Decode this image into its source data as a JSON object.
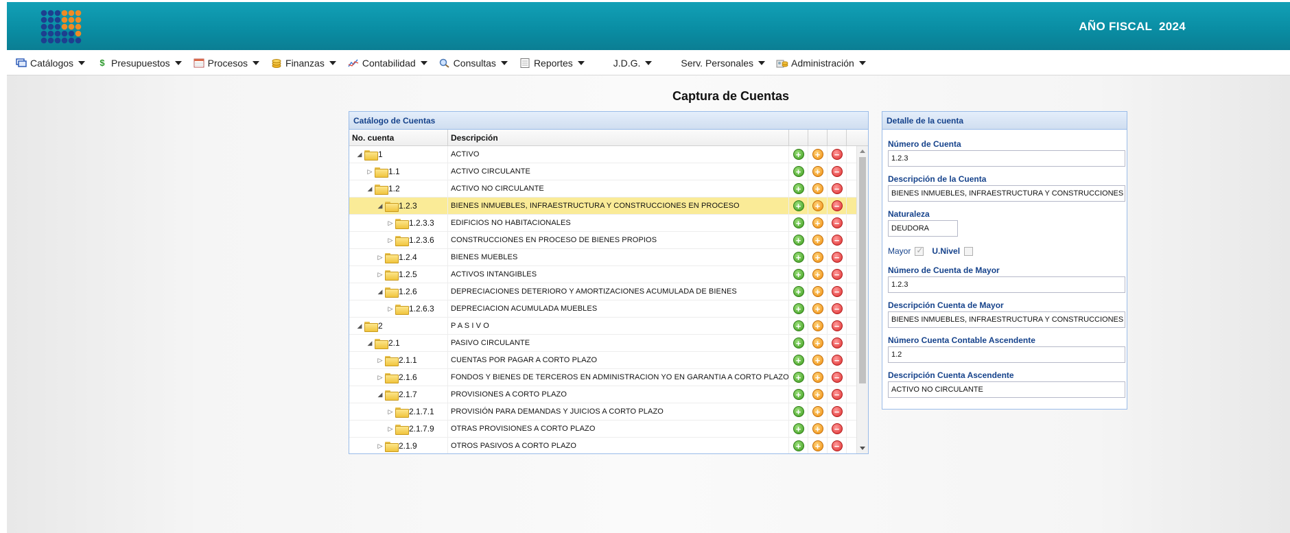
{
  "header": {
    "fiscal_label": "AÑO FISCAL  2024",
    "logo_icon": "app-logo-icon"
  },
  "menu": [
    {
      "label": "Catálogos",
      "icon": "catalog-icon"
    },
    {
      "label": "Presupuestos",
      "icon": "dollar-icon"
    },
    {
      "label": "Procesos",
      "icon": "calendar-icon"
    },
    {
      "label": "Finanzas",
      "icon": "coins-icon"
    },
    {
      "label": "Contabilidad",
      "icon": "chart-icon"
    },
    {
      "label": "Consultas",
      "icon": "search-icon"
    },
    {
      "label": "Reportes",
      "icon": "report-icon"
    },
    {
      "label": "J.D.G.",
      "icon": ""
    },
    {
      "label": "Serv. Personales",
      "icon": ""
    },
    {
      "label": "Administración",
      "icon": "admin-icon"
    }
  ],
  "page": {
    "title": "Captura de Cuentas"
  },
  "catalog": {
    "title": "Catálogo de Cuentas",
    "columns": {
      "number": "No. cuenta",
      "description": "Descripción"
    },
    "rows": [
      {
        "num": "1",
        "desc": "ACTIVO",
        "level": 0,
        "expanded": true,
        "selected": false
      },
      {
        "num": "1.1",
        "desc": "ACTIVO CIRCULANTE",
        "level": 1,
        "expanded": false,
        "selected": false
      },
      {
        "num": "1.2",
        "desc": "ACTIVO NO CIRCULANTE",
        "level": 1,
        "expanded": true,
        "selected": false
      },
      {
        "num": "1.2.3",
        "desc": "BIENES INMUEBLES, INFRAESTRUCTURA Y CONSTRUCCIONES EN PROCESO",
        "level": 2,
        "expanded": true,
        "selected": true
      },
      {
        "num": "1.2.3.3",
        "desc": "EDIFICIOS NO HABITACIONALES",
        "level": 3,
        "expanded": false,
        "selected": false
      },
      {
        "num": "1.2.3.6",
        "desc": "CONSTRUCCIONES EN PROCESO DE BIENES PROPIOS",
        "level": 3,
        "expanded": false,
        "selected": false
      },
      {
        "num": "1.2.4",
        "desc": "BIENES MUEBLES",
        "level": 2,
        "expanded": false,
        "selected": false
      },
      {
        "num": "1.2.5",
        "desc": "ACTIVOS INTANGIBLES",
        "level": 2,
        "expanded": false,
        "selected": false
      },
      {
        "num": "1.2.6",
        "desc": "DEPRECIACIONES DETERIORO Y AMORTIZACIONES ACUMULADA DE BIENES",
        "level": 2,
        "expanded": true,
        "selected": false
      },
      {
        "num": "1.2.6.3",
        "desc": "DEPRECIACION ACUMULADA MUEBLES",
        "level": 3,
        "expanded": false,
        "selected": false
      },
      {
        "num": "2",
        "desc": "P A S I V O",
        "level": 0,
        "expanded": true,
        "selected": false
      },
      {
        "num": "2.1",
        "desc": "PASIVO CIRCULANTE",
        "level": 1,
        "expanded": true,
        "selected": false
      },
      {
        "num": "2.1.1",
        "desc": "CUENTAS POR PAGAR A CORTO PLAZO",
        "level": 2,
        "expanded": false,
        "selected": false
      },
      {
        "num": "2.1.6",
        "desc": "FONDOS Y BIENES DE TERCEROS EN ADMINISTRACION YO EN GARANTIA A CORTO PLAZO",
        "level": 2,
        "expanded": false,
        "selected": false
      },
      {
        "num": "2.1.7",
        "desc": "PROVISIONES A CORTO PLAZO",
        "level": 2,
        "expanded": true,
        "selected": false
      },
      {
        "num": "2.1.7.1",
        "desc": "PROVISIÓN PARA DEMANDAS Y JUICIOS A CORTO PLAZO",
        "level": 3,
        "expanded": false,
        "selected": false
      },
      {
        "num": "2.1.7.9",
        "desc": "OTRAS PROVISIONES A CORTO PLAZO",
        "level": 3,
        "expanded": false,
        "selected": false
      },
      {
        "num": "2.1.9",
        "desc": "OTROS PASIVOS A CORTO PLAZO",
        "level": 2,
        "expanded": false,
        "selected": false
      }
    ]
  },
  "detail": {
    "title": "Detalle de la cuenta",
    "numero_cuenta_label": "Número de Cuenta",
    "numero_cuenta": "1.2.3",
    "descripcion_label": "Descripción de la Cuenta",
    "descripcion": "BIENES INMUEBLES, INFRAESTRUCTURA Y CONSTRUCCIONES EN PROCESO",
    "naturaleza_label": "Naturaleza",
    "naturaleza": "DEUDORA",
    "mayor_label": "Mayor",
    "mayor_checked": true,
    "univel_label": "U.Nivel",
    "univel_checked": false,
    "numero_mayor_label": "Número de Cuenta de Mayor",
    "numero_mayor": "1.2.3",
    "descripcion_mayor_label": "Descripción Cuenta de Mayor",
    "descripcion_mayor": "BIENES INMUEBLES, INFRAESTRUCTURA Y CONSTRUCCIONES EN PROCESO",
    "numero_ascendente_label": "Número Cuenta Contable Ascendente",
    "numero_ascendente": "1.2",
    "descripcion_ascendente_label": "Descripción Cuenta Ascendente",
    "descripcion_ascendente": "ACTIVO NO CIRCULANTE"
  }
}
